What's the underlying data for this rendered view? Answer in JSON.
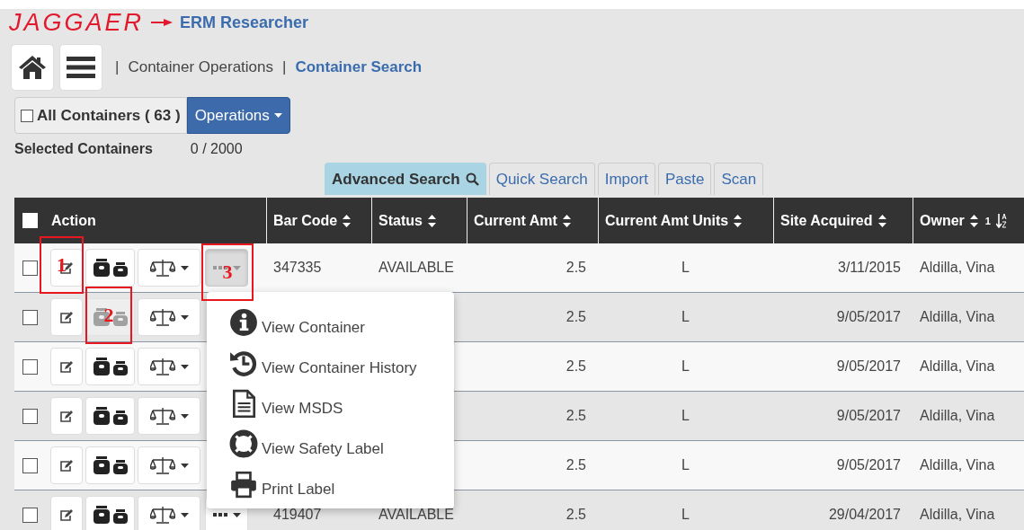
{
  "header": {
    "logo": "JAGGAER",
    "app_name": "ERM Researcher"
  },
  "breadcrumb": [
    {
      "separator": "|",
      "label": "Container Operations",
      "selected": false
    },
    {
      "separator": "|",
      "label": "Container Search",
      "selected": true
    }
  ],
  "all_containers": {
    "label": "All Containers ( 63 )",
    "checked": false
  },
  "operations_button": "Operations",
  "selected_containers": {
    "label": "Selected Containers",
    "value": "0 / 2000"
  },
  "tabs": [
    {
      "label": "Advanced Search",
      "selected": true
    },
    {
      "label": "Quick Search",
      "selected": false
    },
    {
      "label": "Import",
      "selected": false
    },
    {
      "label": "Paste",
      "selected": false
    },
    {
      "label": "Scan",
      "selected": false
    }
  ],
  "table": {
    "select_all_checked": false,
    "columns": [
      {
        "label": "Action",
        "sortable": false
      },
      {
        "label": "Bar Code",
        "sortable": true
      },
      {
        "label": "Status",
        "sortable": true
      },
      {
        "label": "Current Amt",
        "sortable": true
      },
      {
        "label": "Current Amt Units",
        "sortable": true
      },
      {
        "label": "Site Acquired",
        "sortable": true
      },
      {
        "label": "Owner",
        "sortable": true,
        "sort_order": "1"
      }
    ],
    "rows": [
      {
        "checked": false,
        "containers_disabled": false,
        "more_visible": true,
        "menu_open": true,
        "bar_code": "347335",
        "status": "AVAILABLE",
        "current_amt": "2.5",
        "units": "L",
        "site_acquired": "3/11/2015",
        "owner": "Aldilla, Vina"
      },
      {
        "checked": false,
        "containers_disabled": true,
        "more_visible": false,
        "current_amt": "2.5",
        "units": "L",
        "site_acquired": "9/05/2017",
        "owner": "Aldilla, Vina"
      },
      {
        "checked": false,
        "containers_disabled": false,
        "more_visible": false,
        "current_amt": "2.5",
        "units": "L",
        "site_acquired": "9/05/2017",
        "owner": "Aldilla, Vina"
      },
      {
        "checked": false,
        "containers_disabled": false,
        "more_visible": false,
        "current_amt": "2.5",
        "units": "L",
        "site_acquired": "9/05/2017",
        "owner": "Aldilla, Vina"
      },
      {
        "checked": false,
        "containers_disabled": false,
        "more_visible": false,
        "current_amt": "2.5",
        "units": "L",
        "site_acquired": "9/05/2017",
        "owner": "Aldilla, Vina"
      },
      {
        "checked": false,
        "containers_disabled": false,
        "more_visible": true,
        "menu_open": false,
        "bar_code": "419407",
        "status": "AVAILABLE",
        "current_amt": "2.5",
        "units": "L",
        "site_acquired": "29/04/2017",
        "owner": "Aldilla, Vina"
      }
    ]
  },
  "action_menu": [
    {
      "kind": "info",
      "label": "View Container"
    },
    {
      "kind": "history",
      "label": "View Container History"
    },
    {
      "kind": "document",
      "label": "View MSDS"
    },
    {
      "kind": "lifebuoy",
      "label": "View Safety Label"
    },
    {
      "kind": "printer",
      "label": "Print Label"
    }
  ],
  "annotations": [
    {
      "label": "1"
    },
    {
      "label": "2"
    },
    {
      "label": "3"
    }
  ]
}
